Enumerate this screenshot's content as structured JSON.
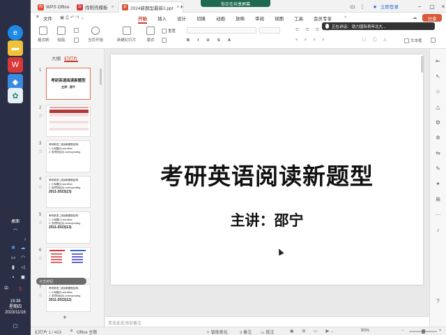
{
  "taskbar": {
    "desktop_label": "桌面",
    "time": "19:38",
    "weekday": "星期四",
    "date": "2023/11/16",
    "ime_label": "中"
  },
  "titlebar": {
    "tabs": [
      {
        "label": "WPS Office",
        "icon": "wps-logo-icon",
        "color": "#e04a36"
      },
      {
        "label": "找稻壳模板",
        "icon": "docer-icon",
        "color": "#d9383a"
      },
      {
        "label": "2024新题型最新2.ppt",
        "icon": "ppt-file-icon",
        "color": "#d9583b"
      }
    ],
    "share_banner": "你正在共享屏幕",
    "login_label": "立即登录"
  },
  "menubar": {
    "file_label": "文件",
    "items": [
      "开始",
      "插入",
      "设计",
      "切换",
      "动画",
      "放映",
      "审阅",
      "视图",
      "工具",
      "会员专享"
    ],
    "active": "开始",
    "share_label": "分享"
  },
  "ribbon": {
    "format_painter": "格式刷",
    "paste": "粘贴",
    "play_from_current": "当页开始",
    "new_slide": "新建幻灯片",
    "layout": "版式",
    "reset": "重置",
    "textbox": "文本框",
    "speaking_notice": "正在讲话：   助力国际青年北大..."
  },
  "left_panel": {
    "tab_outline": "大纲",
    "tab_slides": "幻灯片",
    "slides": [
      {
        "num": "1",
        "title": "考研英语阅读新题型",
        "subtitle": "主讲：邵宁"
      },
      {
        "num": "2"
      },
      {
        "num": "3",
        "lines": [
          "考研英语二阅读新题型结构：",
          "1. 小标题(5)     sub-titles",
          "2. 多项特征(5) corresponding"
        ]
      },
      {
        "num": "4",
        "lines": [
          "考研英语二阅读新题型结构：",
          "1. 小标题(5)     sub-titles",
          "2. 多项特征(5) corresponding",
          "2011-2023(13)"
        ]
      },
      {
        "num": "5",
        "lines": [
          "考研英语二阅读新题型结构：",
          "1. 小标题(7)     sub-titles",
          "2. 多项特征(5) corresponding",
          "2011-2023(13)"
        ]
      },
      {
        "num": "6"
      },
      {
        "num": "7",
        "lines": [
          "考研英语二阅读新题型结构：",
          "1. 小标题(5)     sub-titles",
          "2. 多项特征(5) corresponding",
          "2011-2022(12)"
        ]
      }
    ],
    "floating_label": "点击按钮"
  },
  "slide": {
    "title": "考研英语阅读新题型",
    "subtitle": "主讲：邵宁"
  },
  "notes_placeholder": "单击此处添加备注",
  "statusbar": {
    "slide_counter": "幻灯片 1 / 413",
    "theme": "Office 主题",
    "smart_beautify": "智能美化",
    "notes_toggle": "备注",
    "comments_toggle": "批注",
    "zoom": "90%",
    "zoom_fraction": 0.5
  }
}
